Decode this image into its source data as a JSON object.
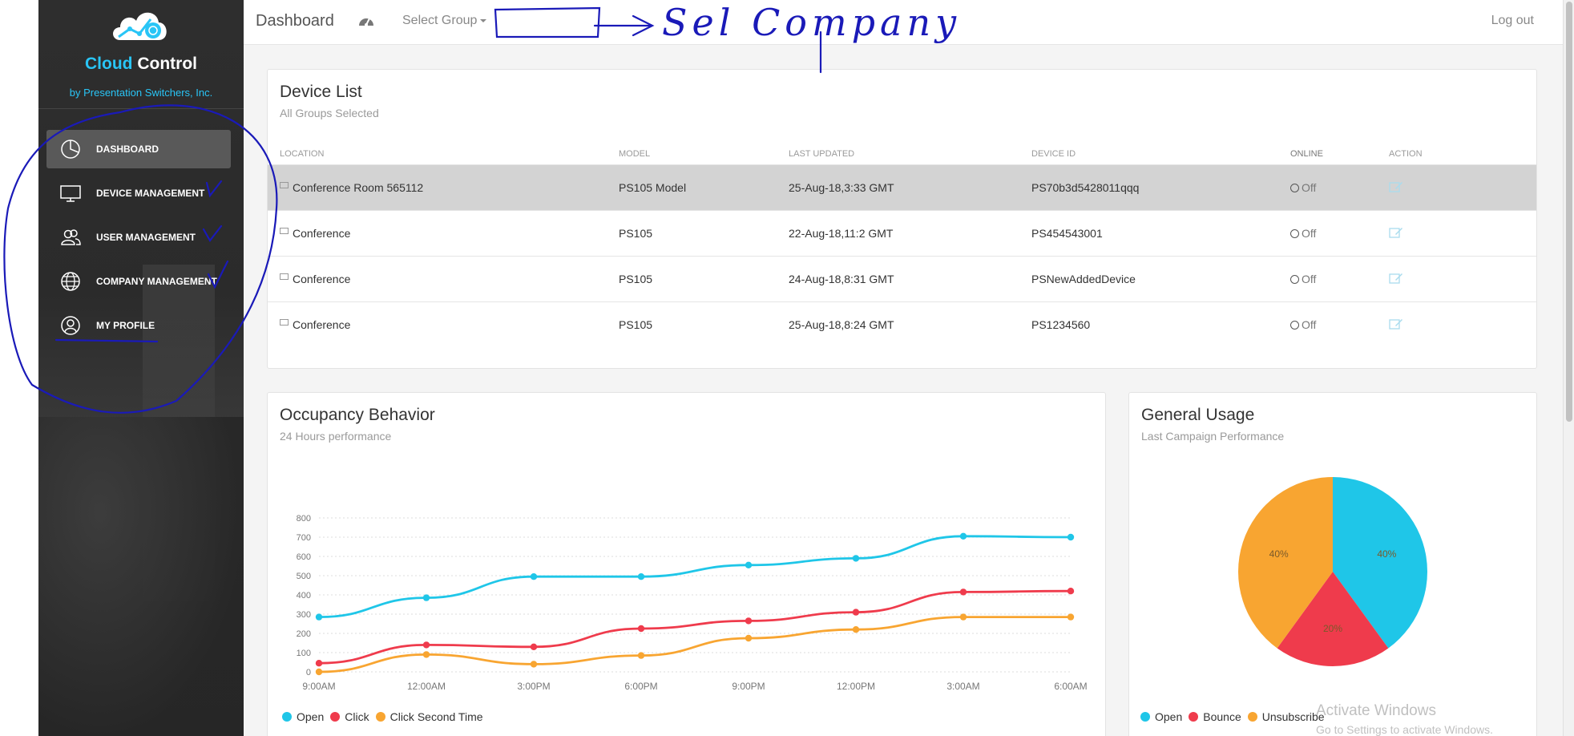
{
  "sidebar": {
    "brand_part1": "Cloud",
    "brand_part2": "Control",
    "brand_sub": "by Presentation Switchers, Inc.",
    "items": [
      {
        "label": "DASHBOARD",
        "icon": "pie-chart-icon",
        "active": true
      },
      {
        "label": "DEVICE MANAGEMENT",
        "icon": "monitor-icon"
      },
      {
        "label": "USER MANAGEMENT",
        "icon": "users-icon"
      },
      {
        "label": "COMPANY MANAGEMENT",
        "icon": "globe-icon"
      },
      {
        "label": "MY PROFILE",
        "icon": "user-icon"
      }
    ]
  },
  "header": {
    "title": "Dashboard",
    "select_group": "Select Group",
    "logout": "Log out"
  },
  "device_list": {
    "title": "Device List",
    "subtitle": "All Groups Selected",
    "columns": [
      "LOCATION",
      "MODEL",
      "LAST UPDATED",
      "DEVICE ID",
      "ONLINE",
      "ACTION"
    ],
    "rows": [
      {
        "location": "Conference Room 565112",
        "model": "PS105 Model",
        "updated": "25-Aug-18,3:33 GMT",
        "device_id": "PS70b3d5428011qqq",
        "online": "Off"
      },
      {
        "location": "Conference",
        "model": "PS105",
        "updated": "22-Aug-18,11:2 GMT",
        "device_id": "PS454543001",
        "online": "Off"
      },
      {
        "location": "Conference",
        "model": "PS105",
        "updated": "24-Aug-18,8:31 GMT",
        "device_id": "PSNewAddedDevice",
        "online": "Off"
      },
      {
        "location": "Conference",
        "model": "PS105",
        "updated": "25-Aug-18,8:24 GMT",
        "device_id": "PS1234560",
        "online": "Off"
      }
    ]
  },
  "occupancy": {
    "title": "Occupancy Behavior",
    "subtitle": "24 Hours performance"
  },
  "usage": {
    "title": "General Usage",
    "subtitle": "Last Campaign Performance"
  },
  "chart_data": [
    {
      "type": "line",
      "x": [
        "9:00AM",
        "12:00AM",
        "3:00PM",
        "6:00PM",
        "9:00PM",
        "12:00PM",
        "3:00AM",
        "6:00AM"
      ],
      "ylim": [
        0,
        800
      ],
      "yticks": [
        0,
        100,
        200,
        300,
        400,
        500,
        600,
        700,
        800
      ],
      "grid": true,
      "legend_placement": "bottom-left",
      "series": [
        {
          "name": "Open",
          "color": "#1fc6e8",
          "values": [
            285,
            385,
            495,
            495,
            555,
            590,
            705,
            700
          ]
        },
        {
          "name": "Click",
          "color": "#ef3b4c",
          "values": [
            45,
            140,
            130,
            225,
            265,
            310,
            415,
            420
          ]
        },
        {
          "name": "Click Second Time",
          "color": "#f8a531",
          "values": [
            0,
            90,
            40,
            85,
            175,
            220,
            285,
            285
          ]
        }
      ]
    },
    {
      "type": "pie",
      "legend_placement": "bottom-left",
      "slices": [
        {
          "name": "Open",
          "value": 40,
          "label": "40%",
          "color": "#1fc6e8"
        },
        {
          "name": "Bounce",
          "value": 20,
          "label": "20%",
          "color": "#ef3b4c"
        },
        {
          "name": "Unsubscribe",
          "value": 40,
          "label": "40%",
          "color": "#f8a531"
        }
      ]
    }
  ],
  "annotations": {
    "handwritten_text": "Sel Company"
  },
  "watermark": {
    "line1": "Activate Windows",
    "line2": "Go to Settings to activate Windows."
  }
}
